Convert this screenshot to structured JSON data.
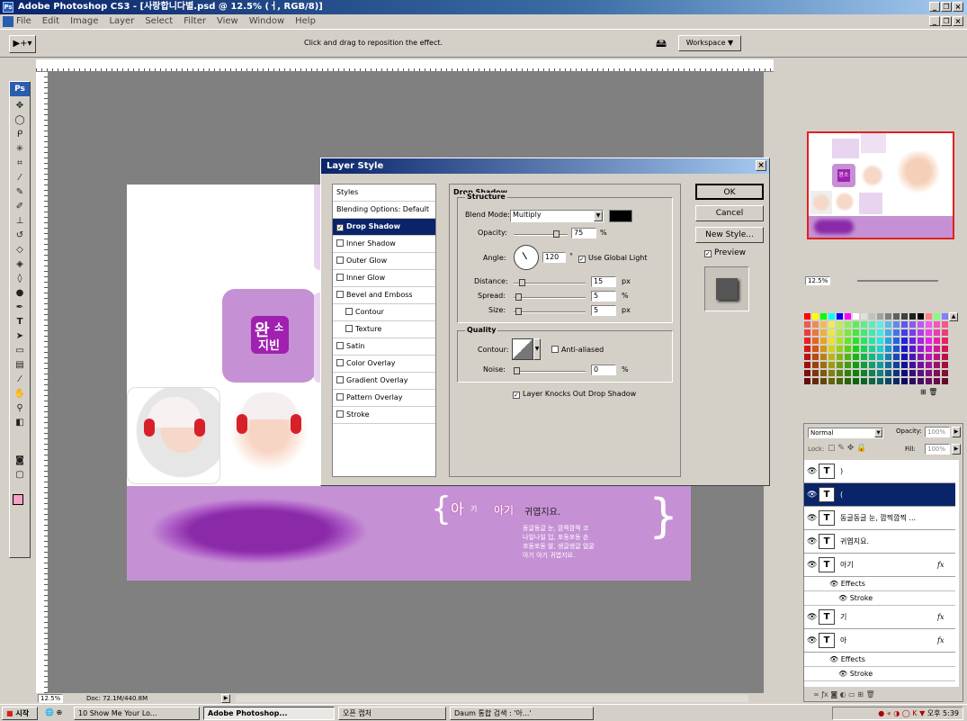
{
  "window": {
    "title": "Adobe Photoshop CS3 - [사랑합니다별.psd @ 12.5% (ㅓ, RGB/8)]"
  },
  "menu": [
    "File",
    "Edit",
    "Image",
    "Layer",
    "Select",
    "Filter",
    "View",
    "Window",
    "Help"
  ],
  "options": {
    "hint": "Click and drag to reposition the effect.",
    "workspace": "Workspace ▼"
  },
  "ruler_ticks": [
    "500",
    "0",
    "500",
    "1000",
    "1500",
    "2000",
    "2500",
    "3000",
    "3500",
    "4000",
    "4500",
    "5000",
    "5500",
    "6000",
    "6500"
  ],
  "document": {
    "logo_line1": "완",
    "logo_small1": "소",
    "logo_line2": "지빈",
    "big_char": "아",
    "small_char": "기",
    "line1_word": "아기",
    "line1_rest": "귀엽지요.",
    "poem": [
      "동글동글 눈, 깜찍깜찍 코",
      "나일나일 입, 포동포동 손",
      "포동포동 발, 생글생글 얼굴",
      "아기 아기 귀엽지요."
    ]
  },
  "dialog": {
    "title": "Layer Style",
    "styles": [
      "Styles",
      "Blending Options: Default",
      "Drop Shadow",
      "Inner Shadow",
      "Outer Glow",
      "Inner Glow",
      "Bevel and Emboss",
      "Contour",
      "Texture",
      "Satin",
      "Color Overlay",
      "Gradient Overlay",
      "Pattern Overlay",
      "Stroke"
    ],
    "section": "Drop Shadow",
    "structure": "Structure",
    "blend_label": "Blend Mode:",
    "blend_value": "Multiply",
    "opacity_label": "Opacity:",
    "opacity": "75",
    "angle_label": "Angle:",
    "angle": "120",
    "global_light": "Use Global Light",
    "distance_label": "Distance:",
    "distance": "15",
    "spread_label": "Spread:",
    "spread": "5",
    "size_label": "Size:",
    "size": "5",
    "px": "px",
    "pct": "%",
    "deg": "°",
    "quality": "Quality",
    "contour_label": "Contour:",
    "anti_aliased": "Anti-aliased",
    "noise_label": "Noise:",
    "noise": "0",
    "knockout": "Layer Knocks Out Drop Shadow",
    "ok": "OK",
    "cancel": "Cancel",
    "new_style": "New Style...",
    "preview": "Preview"
  },
  "navigator": {
    "zoom": "12.5%",
    "logo": "완소"
  },
  "layers": {
    "mode": "Normal",
    "opacity_label": "Opacity:",
    "opacity": "100%",
    "lock_label": "Lock:",
    "fill_label": "Fill:",
    "fill": "100%",
    "rows": [
      {
        "name": ")",
        "fx": ""
      },
      {
        "name": "(",
        "fx": ""
      },
      {
        "name": "동글동글 눈, 깜찍깜찍 ...",
        "fx": ""
      },
      {
        "name": "귀엽지요.",
        "fx": ""
      },
      {
        "name": "아기",
        "fx": "fx"
      },
      {
        "name": "기",
        "fx": "fx"
      },
      {
        "name": "아",
        "fx": "fx"
      }
    ],
    "effects": "Effects",
    "stroke": "Stroke"
  },
  "status": {
    "zoom": "12.5%",
    "doc": "Doc: 72.1M/440.8M"
  },
  "taskbar": {
    "start": "시작",
    "items": [
      "10 Show Me Your Lo...",
      "Adobe Photoshop...",
      "오픈 캡처",
      "Daum 통합 검색 : '아...'"
    ],
    "clock": "오후 5:39"
  },
  "colors": {
    "purple": "#c591d4",
    "deep_purple": "#8a2aa8",
    "logo_bg": "#a020b0",
    "title_blue": "#0a246a"
  }
}
